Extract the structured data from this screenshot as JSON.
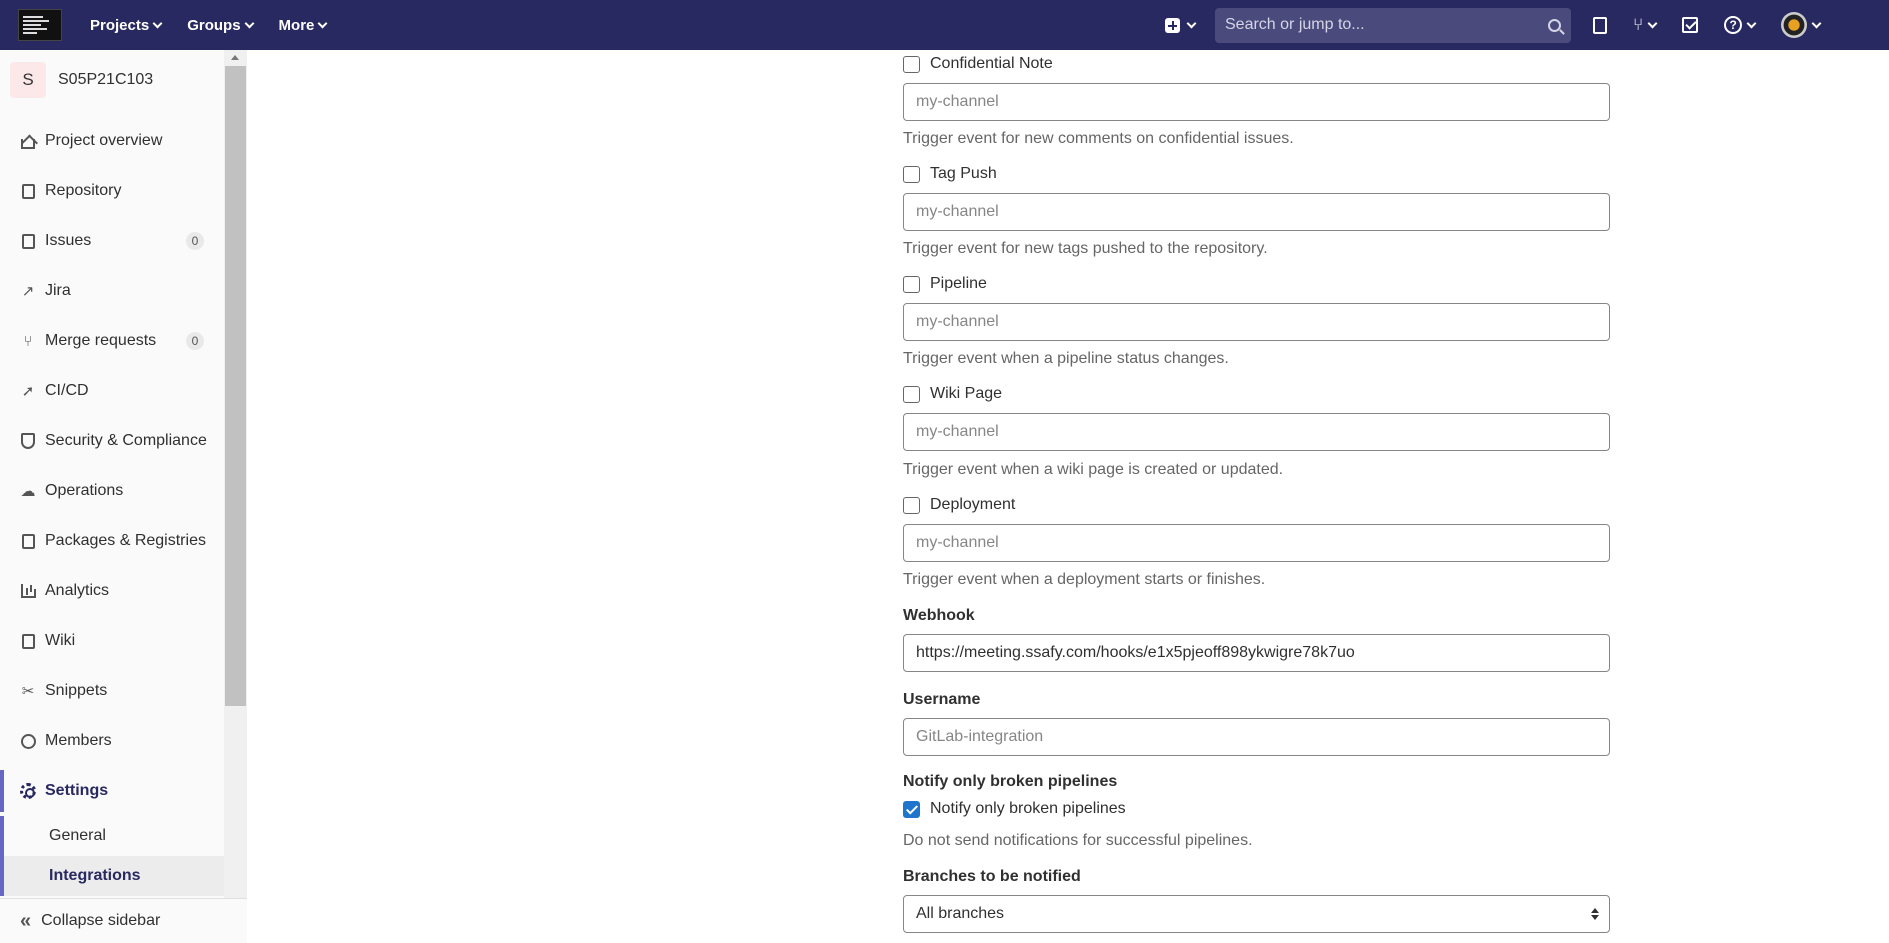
{
  "navbar": {
    "menu": [
      "Projects",
      "Groups",
      "More"
    ],
    "search_placeholder": "Search or jump to..."
  },
  "sidebar": {
    "project_initial": "S",
    "project_name": "S05P21C103",
    "items": [
      {
        "label": "Project overview",
        "icon": "home-icon"
      },
      {
        "label": "Repository",
        "icon": "document-icon"
      },
      {
        "label": "Issues",
        "icon": "issues-icon",
        "badge": "0"
      },
      {
        "label": "Jira",
        "icon": "external-link-icon"
      },
      {
        "label": "Merge requests",
        "icon": "merge-request-icon",
        "badge": "0"
      },
      {
        "label": "CI/CD",
        "icon": "rocket-icon"
      },
      {
        "label": "Security & Compliance",
        "icon": "shield-icon"
      },
      {
        "label": "Operations",
        "icon": "cloud-icon"
      },
      {
        "label": "Packages & Registries",
        "icon": "package-icon"
      },
      {
        "label": "Analytics",
        "icon": "chart-icon"
      },
      {
        "label": "Wiki",
        "icon": "book-icon"
      },
      {
        "label": "Snippets",
        "icon": "scissors-icon"
      },
      {
        "label": "Members",
        "icon": "users-icon"
      },
      {
        "label": "Settings",
        "icon": "gear-icon"
      }
    ],
    "sub_items": [
      "General",
      "Integrations"
    ],
    "collapse_label": "Collapse sidebar"
  },
  "form": {
    "events": [
      {
        "label": "Confidential Note",
        "placeholder": "my-channel",
        "help": "Trigger event for new comments on confidential issues."
      },
      {
        "label": "Tag Push",
        "placeholder": "my-channel",
        "help": "Trigger event for new tags pushed to the repository."
      },
      {
        "label": "Pipeline",
        "placeholder": "my-channel",
        "help": "Trigger event when a pipeline status changes."
      },
      {
        "label": "Wiki Page",
        "placeholder": "my-channel",
        "help": "Trigger event when a wiki page is created or updated."
      },
      {
        "label": "Deployment",
        "placeholder": "my-channel",
        "help": "Trigger event when a deployment starts or finishes."
      }
    ],
    "webhook_label": "Webhook",
    "webhook_value": "https://meeting.ssafy.com/hooks/e1x5pjeoff898ykwigre78k7uo",
    "username_label": "Username",
    "username_placeholder": "GitLab-integration",
    "notify_label": "Notify only broken pipelines",
    "notify_checkbox_label": "Notify only broken pipelines",
    "notify_help": "Do not send notifications for successful pipelines.",
    "branches_label": "Branches to be notified",
    "branches_value": "All branches"
  }
}
